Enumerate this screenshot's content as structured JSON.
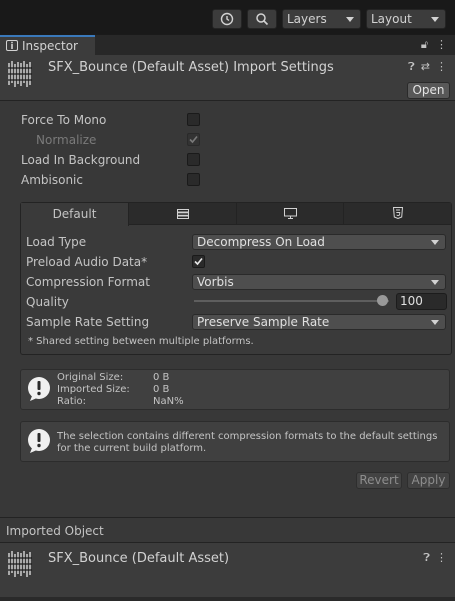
{
  "toolbar": {
    "history_icon": "history-icon",
    "search_icon": "search-icon",
    "layers_label": "Layers",
    "layout_label": "Layout"
  },
  "tab": {
    "label": "Inspector",
    "lock_icon": "lock-icon",
    "menu_icon": "kebab-menu-icon"
  },
  "header": {
    "title": "SFX_Bounce (Default Asset) Import Settings",
    "open_label": "Open",
    "help_icon": "help-icon",
    "presets_icon": "presets-icon",
    "menu_icon": "kebab-menu-icon"
  },
  "settings": {
    "force_to_mono": {
      "label": "Force To Mono",
      "checked": false
    },
    "normalize": {
      "label": "Normalize",
      "checked": true,
      "disabled": true
    },
    "load_in_background": {
      "label": "Load In Background",
      "checked": false
    },
    "ambisonic": {
      "label": "Ambisonic",
      "checked": false
    }
  },
  "platform": {
    "tabs": [
      {
        "label": "Default",
        "icon": "",
        "active": true
      },
      {
        "label": "",
        "icon": "server-icon",
        "active": false
      },
      {
        "label": "",
        "icon": "monitor-icon",
        "active": false
      },
      {
        "label": "",
        "icon": "html5-icon",
        "active": false
      }
    ],
    "load_type": {
      "label": "Load Type",
      "value": "Decompress On Load"
    },
    "preload": {
      "label": "Preload Audio Data*",
      "checked": true
    },
    "compression": {
      "label": "Compression Format",
      "value": "Vorbis"
    },
    "quality": {
      "label": "Quality",
      "value": "100",
      "fraction": 1.0
    },
    "sample_rate": {
      "label": "Sample Rate Setting",
      "value": "Preserve Sample Rate"
    },
    "note": "* Shared setting between multiple platforms."
  },
  "size_info": {
    "original_label": "Original Size:",
    "original_value": "0 B",
    "imported_label": "Imported Size:",
    "imported_value": "0 B",
    "ratio_label": "Ratio:",
    "ratio_value": "NaN%"
  },
  "warning": {
    "text": "The selection contains different compression formats to the default settings for the current build platform."
  },
  "actions": {
    "revert_label": "Revert",
    "apply_label": "Apply"
  },
  "imported_object": {
    "section_label": "Imported Object",
    "title": "SFX_Bounce (Default Asset)",
    "help_icon": "help-icon",
    "menu_icon": "kebab-menu-icon"
  },
  "colors": {
    "accent": "#3a79bb",
    "panel": "#383838",
    "header": "#3c3c3c"
  }
}
